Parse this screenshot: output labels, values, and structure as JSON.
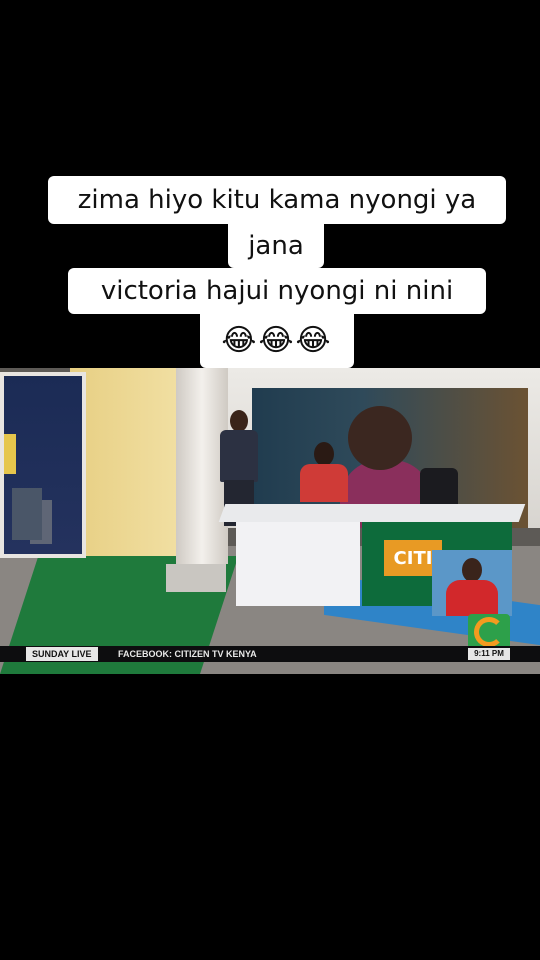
{
  "caption": {
    "line1": "zima hiyo kitu kama nyongi ya",
    "line2": "jana",
    "line3": "victoria hajui nyongi ni nini",
    "emoji": "😂😂😂"
  },
  "broadcast": {
    "show_label": "SUNDAY LIVE",
    "ticker_text": "FACEBOOK: CITIZEN TV KENYA",
    "time": "9:11 PM",
    "desk_logo_text": "CITI"
  },
  "colors": {
    "background": "#000000",
    "caption_bg": "#ffffff",
    "channel_green": "#2da04a",
    "channel_orange": "#f39b1f"
  }
}
